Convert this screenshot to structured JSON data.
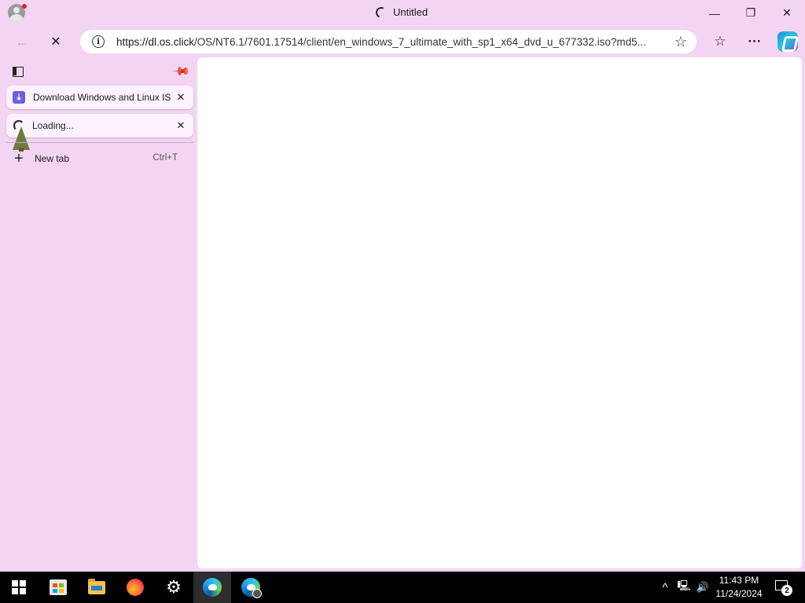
{
  "window": {
    "title": "Untitled",
    "minimize_glyph": "—",
    "restore_glyph": "❐",
    "close_glyph": "✕"
  },
  "toolbar": {
    "back_glyph": "←",
    "stop_glyph": "✕",
    "url_host": "https://dl.os.click",
    "url_path": "/OS/NT6.1/7601.17514/client/en_windows_7_ultimate_with_sp1_x64_dvd_u_677332.iso?md5...",
    "info_glyph": "i",
    "favorite_glyph": "☆",
    "favorites_glyph": "☆",
    "more_glyph": "···"
  },
  "vertical_tabs": {
    "tabs": [
      {
        "label": "Download Windows and Linux ISO",
        "icon": "download-favicon",
        "fav_glyph": "⤓",
        "close_glyph": "✕"
      },
      {
        "label": "Loading...",
        "icon": "loading-spinner",
        "close_glyph": "✕"
      }
    ],
    "new_tab": {
      "label": "New tab",
      "shortcut": "Ctrl+T",
      "plus_glyph": "+"
    }
  },
  "taskbar": {
    "apps": [
      "start",
      "microsoft-store",
      "file-explorer",
      "firefox",
      "settings",
      "edge",
      "edge-beta"
    ],
    "gear_glyph": "⚙",
    "tray": {
      "chevron": "^",
      "network": "🖳",
      "volume": "🔊"
    },
    "time": "11:43 PM",
    "date": "11/24/2024",
    "notification_count": "2"
  }
}
